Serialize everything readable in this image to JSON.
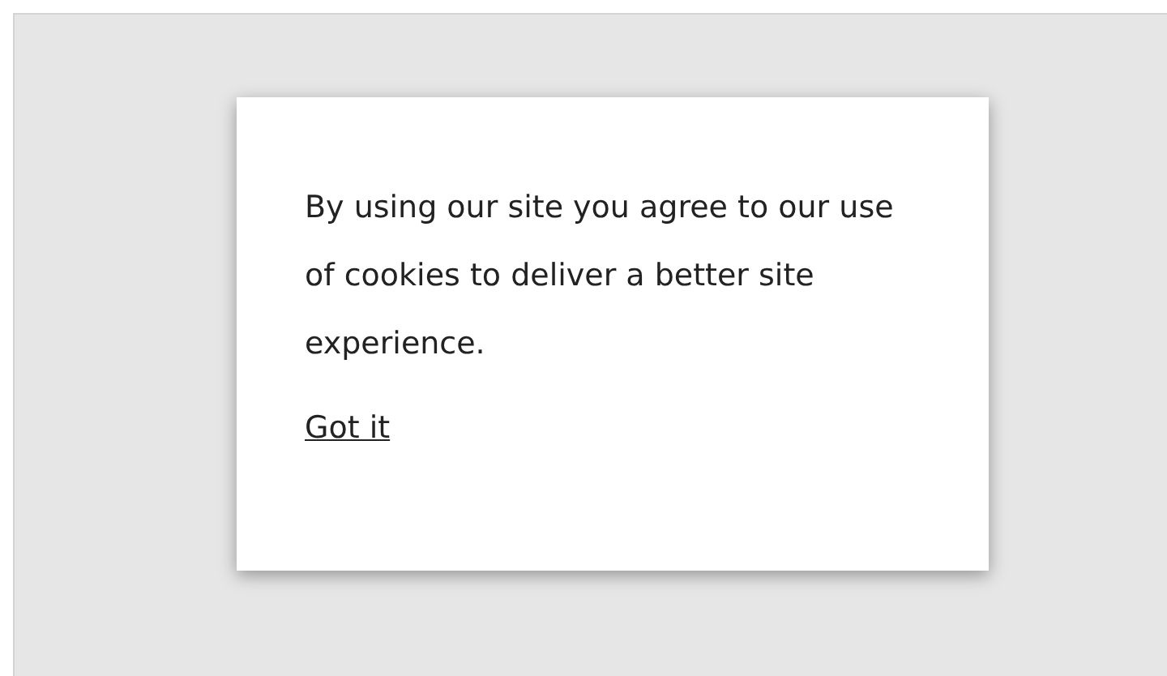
{
  "cookie_notice": {
    "message": "By using our site you agree to our use of cookies to deliver a better site experience.",
    "link": "Got it"
  }
}
